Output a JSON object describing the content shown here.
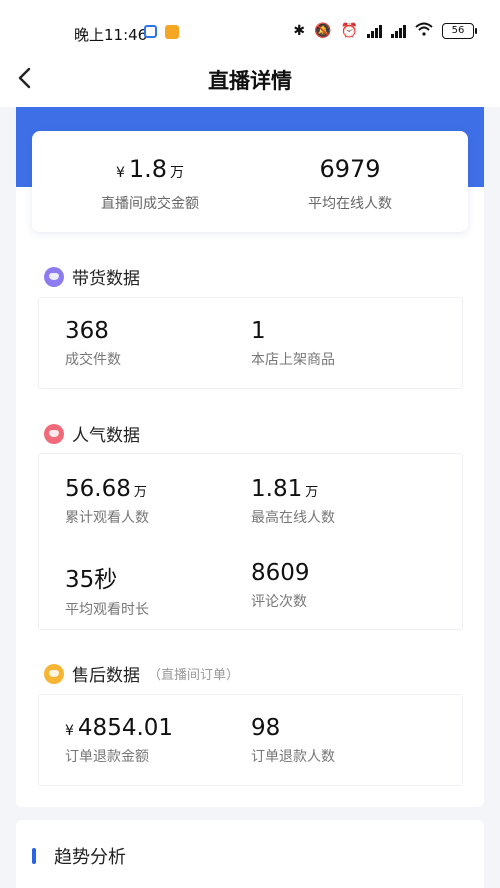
{
  "status_bar": {
    "time": "晚上11:46",
    "battery": "56"
  },
  "nav": {
    "title": "直播详情"
  },
  "summary": [
    {
      "currency": "¥",
      "value": "1.8",
      "unit": "万",
      "label": "直播间成交金额"
    },
    {
      "currency": "",
      "value": "6979",
      "unit": "",
      "label": "平均在线人数"
    }
  ],
  "sections": {
    "goods": {
      "title": "带货数据",
      "items": [
        {
          "value": "368",
          "label": "成交件数"
        },
        {
          "value": "1",
          "label": "本店上架商品"
        }
      ]
    },
    "popularity": {
      "title": "人气数据",
      "items": [
        {
          "value": "56.68",
          "unit": "万",
          "label": "累计观看人数"
        },
        {
          "value": "1.81",
          "unit": "万",
          "label": "最高在线人数"
        },
        {
          "value": "35秒",
          "unit": "",
          "label": "平均观看时长"
        },
        {
          "value": "8609",
          "unit": "",
          "label": "评论次数"
        }
      ]
    },
    "after_sales": {
      "title": "售后数据",
      "subtitle": "（直播间订单）",
      "items": [
        {
          "currency": "¥",
          "value": "4854.01",
          "label": "订单退款金额"
        },
        {
          "value": "98",
          "label": "订单退款人数"
        }
      ]
    }
  },
  "trend": {
    "title": "趋势分析"
  },
  "colors": {
    "accent": "#3f6fe6",
    "goods_icon": "#8c7cf0",
    "popularity_icon": "#f06a7a",
    "after_sales_icon": "#f7b534"
  }
}
